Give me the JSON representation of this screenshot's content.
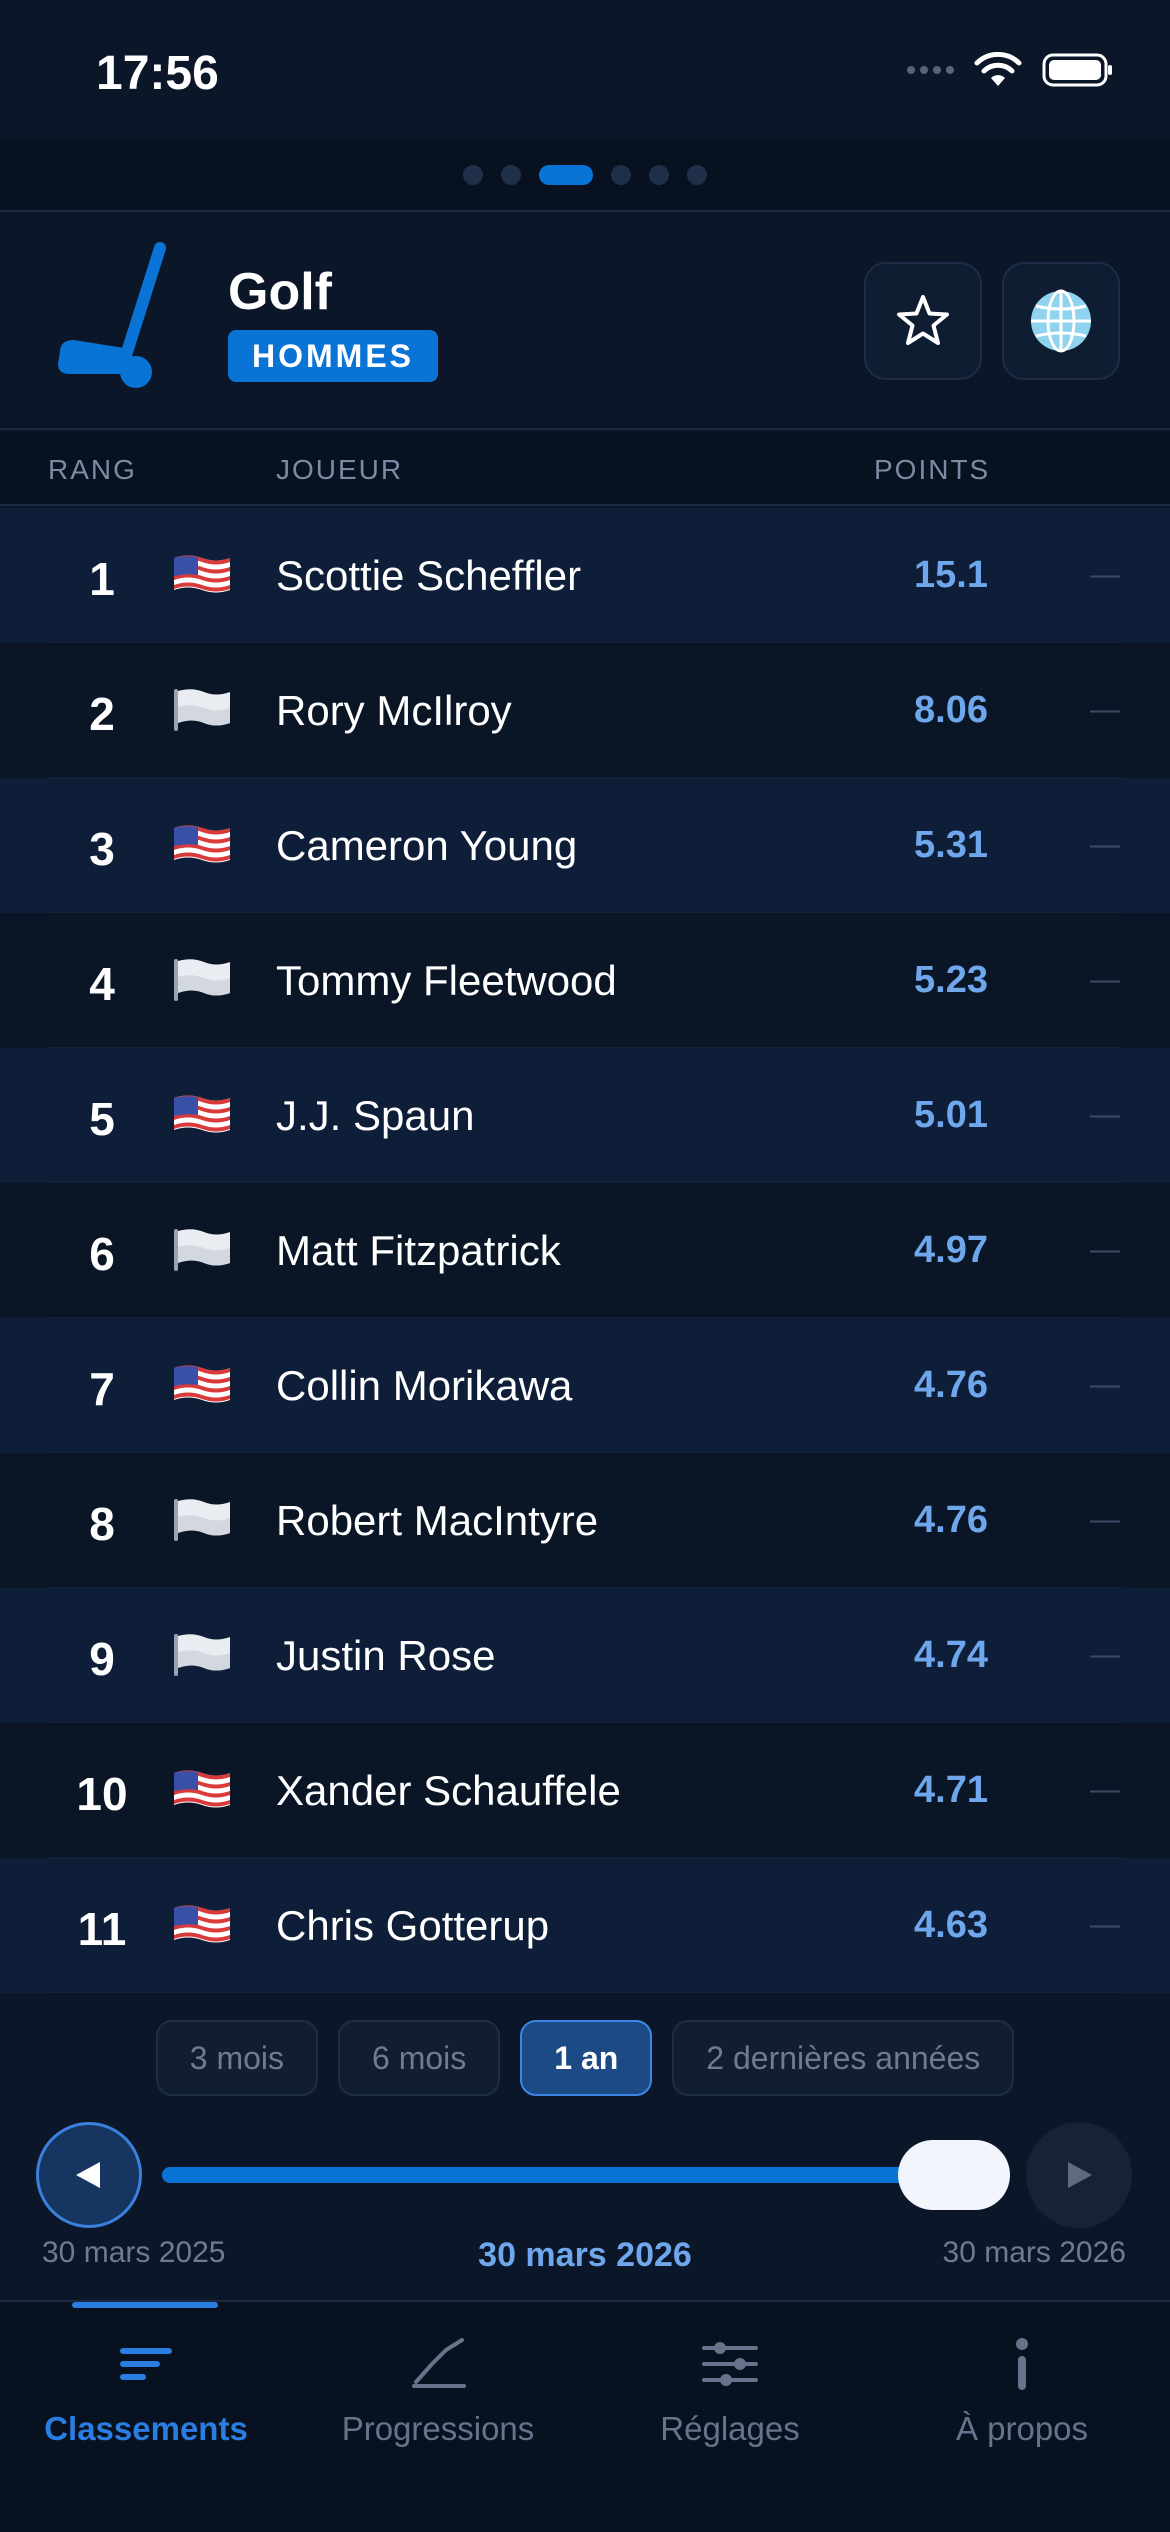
{
  "status": {
    "time": "17:56"
  },
  "header": {
    "sport": "Golf",
    "gender": "HOMMES",
    "sport_icon": "golf-club-icon",
    "fav_icon": "star-icon",
    "globe_icon": "globe-icon"
  },
  "pager": {
    "count": 6,
    "active": 2
  },
  "table": {
    "columns": {
      "rank": "RANG",
      "player": "JOUEUR",
      "points": "POINTS"
    },
    "rows": [
      {
        "rank": "1",
        "flag": "us",
        "player": "Scottie Scheffler",
        "points": "15.1",
        "trend": "—"
      },
      {
        "rank": "2",
        "flag": "white",
        "player": "Rory McIlroy",
        "points": "8.06",
        "trend": "—"
      },
      {
        "rank": "3",
        "flag": "us",
        "player": "Cameron Young",
        "points": "5.31",
        "trend": "—"
      },
      {
        "rank": "4",
        "flag": "white",
        "player": "Tommy Fleetwood",
        "points": "5.23",
        "trend": "—"
      },
      {
        "rank": "5",
        "flag": "us",
        "player": "J.J. Spaun",
        "points": "5.01",
        "trend": "—"
      },
      {
        "rank": "6",
        "flag": "white",
        "player": "Matt Fitzpatrick",
        "points": "4.97",
        "trend": "—"
      },
      {
        "rank": "7",
        "flag": "us",
        "player": "Collin Morikawa",
        "points": "4.76",
        "trend": "—"
      },
      {
        "rank": "8",
        "flag": "white",
        "player": "Robert MacIntyre",
        "points": "4.76",
        "trend": "—"
      },
      {
        "rank": "9",
        "flag": "white",
        "player": "Justin Rose",
        "points": "4.74",
        "trend": "—"
      },
      {
        "rank": "10",
        "flag": "us",
        "player": "Xander Schauffele",
        "points": "4.71",
        "trend": "—"
      },
      {
        "rank": "11",
        "flag": "us",
        "player": "Chris Gotterup",
        "points": "4.63",
        "trend": "—"
      }
    ]
  },
  "periods": [
    {
      "label": "3 mois",
      "active": false
    },
    {
      "label": "6 mois",
      "active": false
    },
    {
      "label": "1 an",
      "active": true
    },
    {
      "label": "2 dernières années",
      "active": false
    }
  ],
  "timeline": {
    "start": "30 mars 2025",
    "current": "30 mars 2026",
    "end": "30 mars 2026",
    "progress": 1.0,
    "play_icon": "play-reverse-icon",
    "next_icon": "play-icon"
  },
  "tabs": [
    {
      "label": "Classements",
      "icon": "list-icon",
      "active": true
    },
    {
      "label": "Progressions",
      "icon": "chart-line-icon",
      "active": false
    },
    {
      "label": "Réglages",
      "icon": "sliders-icon",
      "active": false
    },
    {
      "label": "À propos",
      "icon": "info-icon",
      "active": false
    }
  ],
  "colors": {
    "accent": "#0a74d6",
    "points": "#6fa7ec",
    "background": "#0b1628"
  }
}
